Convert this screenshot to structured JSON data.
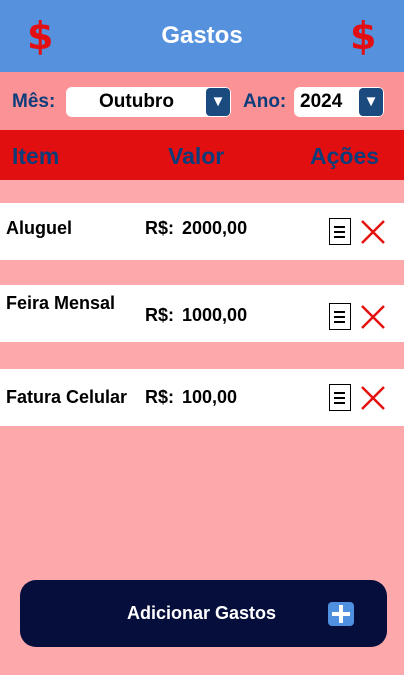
{
  "header": {
    "title": "Gastos",
    "icon_left": "$",
    "icon_right": "$"
  },
  "filters": {
    "month_label": "Mês:",
    "month_value": "Outubro",
    "year_label": "Ano:",
    "year_value": "2024",
    "dropdown_glyph": "▼"
  },
  "table": {
    "headers": {
      "item": "Item",
      "value": "Valor",
      "actions": "Ações"
    },
    "rows": [
      {
        "item": "Aluguel",
        "currency": "R$:",
        "value": "2000,00"
      },
      {
        "item": "Feira Mensal",
        "currency": "R$:",
        "value": "1000,00"
      },
      {
        "item": "Fatura Celular",
        "currency": "R$:",
        "value": "100,00"
      }
    ]
  },
  "footer": {
    "add_label": "Adicionar Gastos"
  },
  "colors": {
    "header_bg": "#5591dd",
    "table_header_bg": "#e20f10",
    "page_bg": "#fda9ac",
    "button_bg": "#060f3c",
    "accent_red": "#e30e12"
  }
}
